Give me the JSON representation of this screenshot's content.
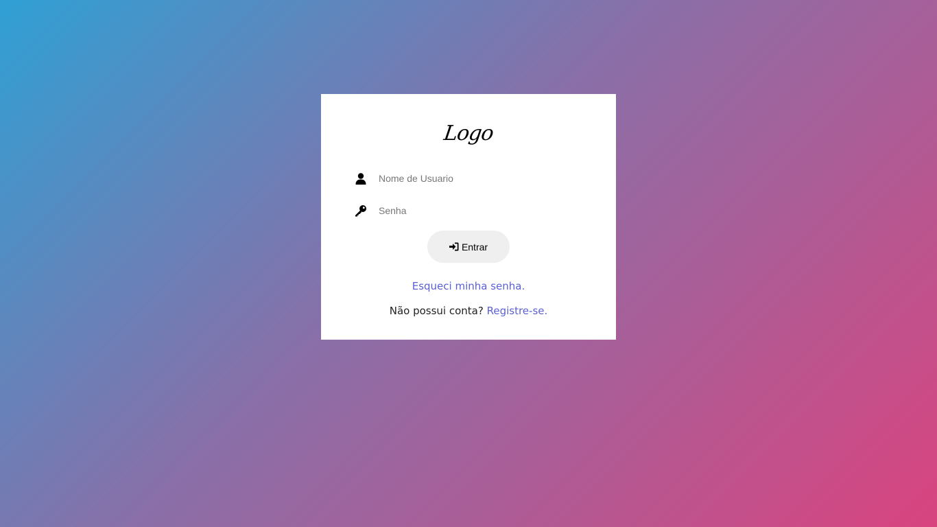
{
  "colors": {
    "background_start": "#2fa0d4",
    "background_end": "#d9447f",
    "link": "#5a5fd6",
    "button_bg": "#efefef"
  },
  "login": {
    "logo_text": "Logo",
    "username": {
      "icon": "user-icon",
      "placeholder": "Nome de Usuario",
      "value": ""
    },
    "password": {
      "icon": "key-icon",
      "placeholder": "Senha",
      "value": ""
    },
    "submit": {
      "icon": "sign-in-icon",
      "label": "Entrar"
    },
    "forgot_link": "Esqueci minha senha.",
    "register_prompt": "Não possui conta?",
    "register_link": "Registre-se."
  }
}
